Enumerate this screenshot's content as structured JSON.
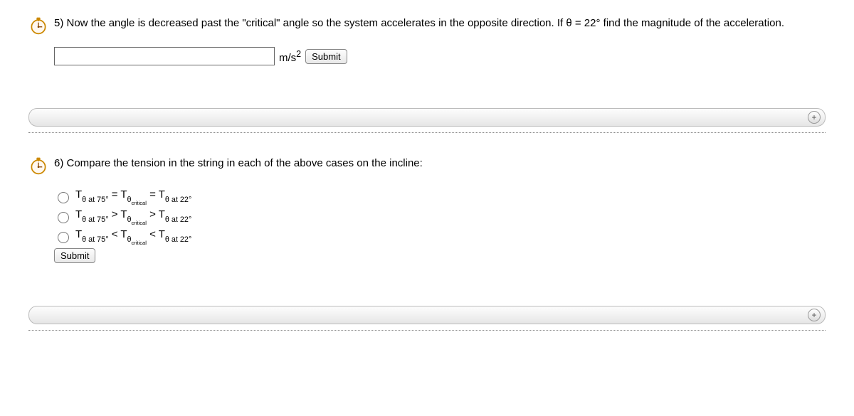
{
  "q5": {
    "prompt": "5) Now the angle is decreased past the \"critical\" angle so the system accelerates in the opposite direction. If θ = 22° find the magnitude of the acceleration.",
    "unit_html": "m/s<sup>2</sup>",
    "submit": "Submit"
  },
  "q6": {
    "prompt": "6) Compare the tension in the string in each of the above cases on the incline:",
    "options": [
      {
        "rel": "=",
        "rel2": "="
      },
      {
        "rel": ">",
        "rel2": ">"
      },
      {
        "rel": "<",
        "rel2": "<"
      }
    ],
    "labels": {
      "T": "T",
      "theta": "θ at 75°",
      "theta_crit_sub": "θ",
      "critical": "critical",
      "theta22": "θ at 22°"
    },
    "submit": "Submit"
  },
  "icons": {
    "plus": "+"
  }
}
